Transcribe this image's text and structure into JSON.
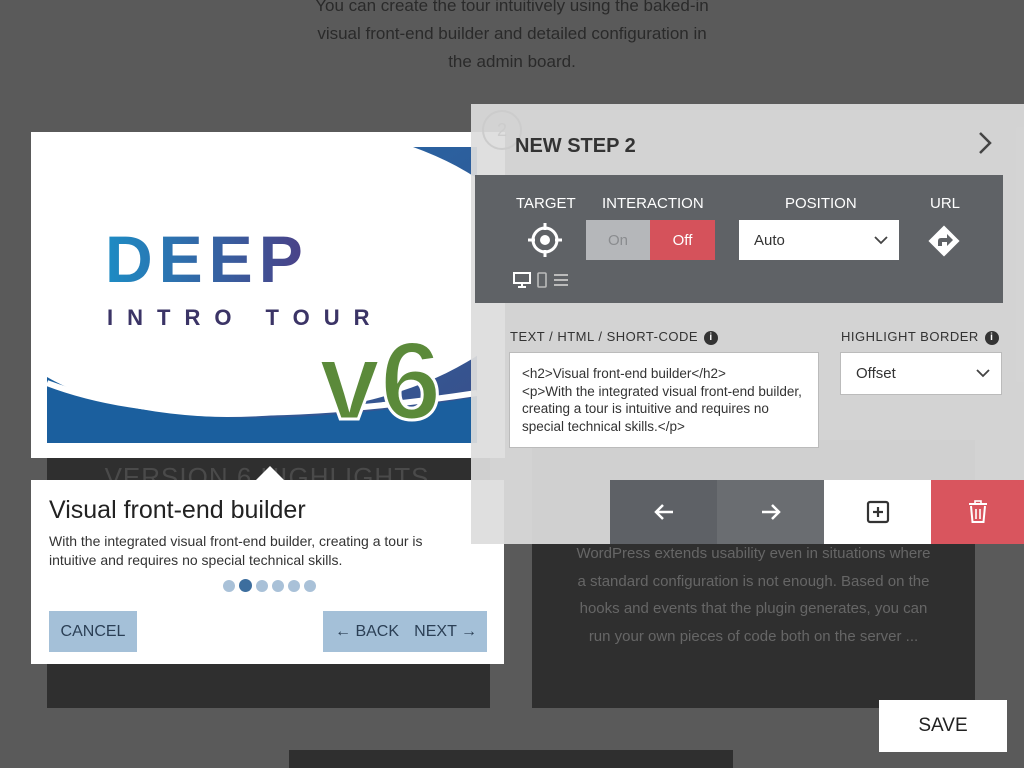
{
  "background": {
    "intro_lines": [
      "You can create the tour intuitively using the baked-in",
      "visual front-end builder and detailed configuration in",
      "the admin board."
    ],
    "left_card_title": "VERSION 6 HIGHLIGHTS",
    "right_card_text": "WordPress extends usability even in situations where a standard configuration is not enough. Based on the hooks and events that the plugin generates, you can run your own pieces of code both on the server ..."
  },
  "image": {
    "brand": "DEEP",
    "subtitle": "INTRO TOUR",
    "version": "v6"
  },
  "tooltip": {
    "title": "Visual front-end builder",
    "text": "With the integrated visual front-end builder, creating a tour is intuitive and requires no special technical skills.",
    "dots_total": 6,
    "dots_active_index": 1,
    "cancel_label": "CANCEL",
    "back_label": "← BACK",
    "next_label": "NEXT →"
  },
  "panel": {
    "step_badge": "2",
    "title": "NEW STEP 2",
    "target_label": "TARGET",
    "interaction_label": "INTERACTION",
    "interaction_on": "On",
    "interaction_off": "Off",
    "position_label": "POSITION",
    "position_value": "Auto",
    "url_label": "URL",
    "text_label": "TEXT / HTML / SHORT-CODE",
    "text_value": "<h2>Visual front-end builder</h2>\n<p>With the integrated visual front-end builder, creating a tour is intuitive and requires no special technical skills.</p>",
    "highlight_label": "HIGHLIGHT BORDER",
    "highlight_value": "Offset"
  },
  "save_label": "SAVE",
  "colors": {
    "accent_red": "#d5525b",
    "tooltip_button": "#a4c0d8",
    "config_bar": "#5f6266"
  }
}
